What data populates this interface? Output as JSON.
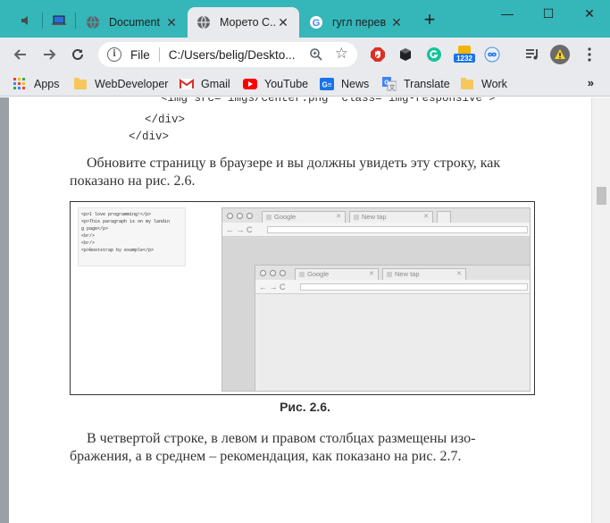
{
  "browser": {
    "tabs": [
      {
        "title": "Document",
        "favicon": "globe-icon",
        "active": false
      },
      {
        "title": "Морето С...",
        "favicon": "globe-icon",
        "active": true
      },
      {
        "title": "гугл перев",
        "favicon": "google-icon",
        "active": false
      }
    ],
    "window_controls": {
      "minimize": "—",
      "maximize": "☐",
      "close": "✕"
    },
    "address": {
      "scheme": "File",
      "url": "C:/Users/belig/Deskto..."
    },
    "extensions": [
      {
        "name": "adblock-icon"
      },
      {
        "name": "cube-extension-icon"
      },
      {
        "name": "grammarly-icon"
      },
      {
        "name": "calendar-extension-icon",
        "badge": "1232"
      },
      {
        "name": "infinity-extension-icon"
      },
      {
        "name": "media-control-icon"
      },
      {
        "name": "profile-avatar-icon"
      },
      {
        "name": "menu-icon"
      }
    ],
    "bookmarks": [
      {
        "label": "Apps",
        "icon": "apps-grid-icon"
      },
      {
        "label": "WebDeveloper",
        "icon": "folder-icon"
      },
      {
        "label": "Gmail",
        "icon": "gmail-icon"
      },
      {
        "label": "YouTube",
        "icon": "youtube-icon"
      },
      {
        "label": "News",
        "icon": "news-icon"
      },
      {
        "label": "Translate",
        "icon": "translate-icon"
      },
      {
        "label": "Work",
        "icon": "folder-icon"
      }
    ],
    "bookmarks_overflow": "»"
  },
  "document": {
    "code_lines": [
      "<img src=\"imgs/center.png\" class=\"img-responsive\">",
      "</div>",
      "</div>"
    ],
    "paragraph1_line1": "Обновите страницу в браузере и вы должны увидеть эту строку, как",
    "paragraph1_line2": "показано на рис. 2.6.",
    "figure": {
      "code_snippet": "<p>I love programming!</p>\n<p>This paragraph is on my landin\ng page</p>\n<br/>\n<br/>\n<p>Bootstrap by example</p>",
      "outer_tabs": [
        "Google",
        "New tap"
      ],
      "inner_tabs": [
        "Google",
        "New tap"
      ],
      "nav_arrows": "← → C",
      "caption": "Рис. 2.6."
    },
    "paragraph2_line1": "В четвертой строке, в левом и правом столбцах размещены изо-",
    "paragraph2_line2": "бражения, а в среднем – рекомендация, как показано на рис. 2.7."
  },
  "colors": {
    "tabstrip": "#35b6b9",
    "toolbar": "#e8eaed",
    "page_text": "#333333"
  }
}
